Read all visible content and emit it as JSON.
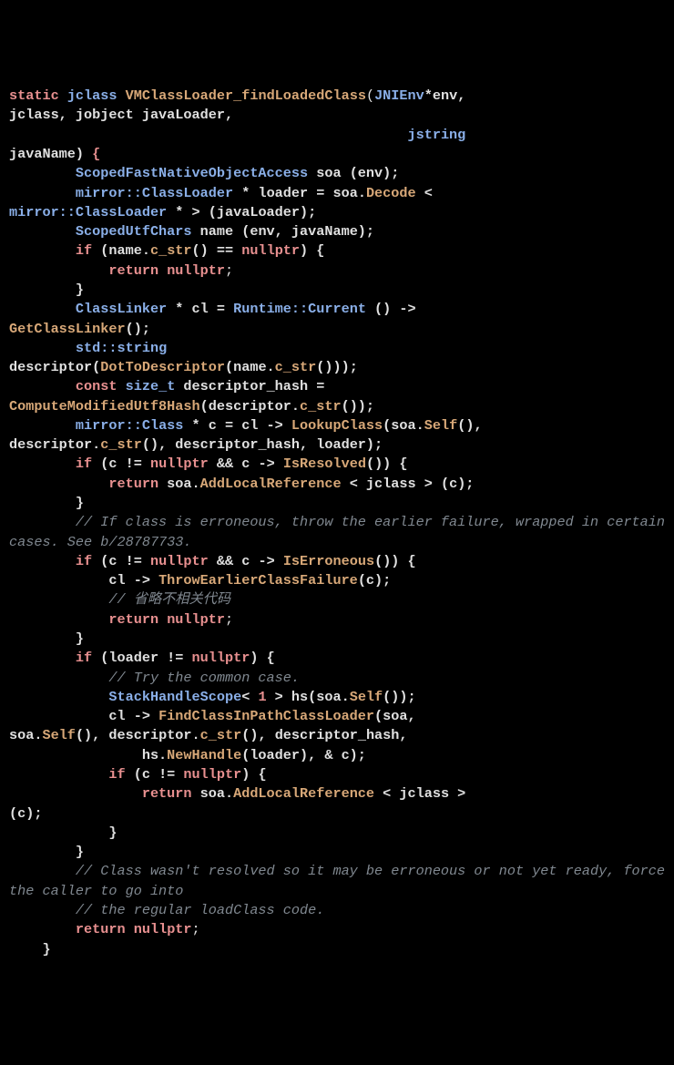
{
  "code": {
    "l1_static": "static",
    "l1_jclass": "jclass",
    "l1_fn": "VMClassLoader_findLoadedClass",
    "l1_jnienv": "JNIEnv",
    "l1_env": "*env,",
    "l2_jclass": "jclass, jobject javaLoader,",
    "l3_jstring": "jstring",
    "l4_javaname": "javaName)",
    "l4_brace": "{",
    "l5_scopedfast": "ScopedFastNativeObjectAccess",
    "l5_soa": " soa (env);",
    "l6_mirror": "mirror::",
    "l6_classloader": "ClassLoader",
    "l6_star": " * loader = soa.",
    "l6_decode": "Decode",
    "l6_lt": " <",
    "l7_mirror": "mirror::",
    "l7_classloader": "ClassLoader",
    "l7_rest": " * > (javaLoader);",
    "l8_scopedutf": "ScopedUtfChars",
    "l8_name": " name (env, javaName);",
    "l9_if": "if",
    "l9_cond": " (name.",
    "l9_cstr": "c_str",
    "l9_eq": "() == ",
    "l9_nullptr": "nullptr",
    "l9_brace": ") {",
    "l10_return": "return",
    "l10_nullptr": "nullptr",
    "l10_semi": ";",
    "l11_brace": "}",
    "l12_classlinker": "ClassLinker",
    "l12_cl": " * cl = ",
    "l12_runtime": "Runtime::Current",
    "l12_arrow": " () ->",
    "l13_getcl": "GetClassLinker",
    "l13_paren": "();",
    "l14_std": "std::",
    "l14_string": "string",
    "l15_desc": "descriptor(",
    "l15_dot": "DotToDescriptor",
    "l15_name": "(name.",
    "l15_cstr": "c_str",
    "l15_end": "()));",
    "l16_const": "const",
    "l16_sizet": "size_t",
    "l16_hash": " descriptor_hash =",
    "l17_compute": "ComputeModifiedUtf8Hash",
    "l17_desc": "(descriptor.",
    "l17_cstr": "c_str",
    "l17_end": "());",
    "l18_mirror": "mirror::",
    "l18_class": "Class",
    "l18_c": " * c = cl -> ",
    "l18_lookup": "LookupClass",
    "l18_soa": "(soa.",
    "l18_self": "Self",
    "l18_end": "(),",
    "l19_desc": "descriptor.",
    "l19_cstr": "c_str",
    "l19_rest": "(), descriptor_hash, loader);",
    "l20_if": "if",
    "l20_c": " (c != ",
    "l20_nullptr": "nullptr",
    "l20_and": " && c -> ",
    "l20_isres": "IsResolved",
    "l20_brace": "()) {",
    "l21_return": "return",
    "l21_soa": " soa.",
    "l21_add": "AddLocalReference",
    "l21_jclass": " < jclass > (c);",
    "l22_brace": "}",
    "l23_comment": "// If class is erroneous, throw the earlier failure, wrapped in certain cases. See b/28787733.",
    "l25_if": "if",
    "l25_c": " (c != ",
    "l25_nullptr": "nullptr",
    "l25_and": " && c -> ",
    "l25_iserr": "IsErroneous",
    "l25_brace": "()) {",
    "l26_cl": "cl -> ",
    "l26_throw": "ThrowEarlierClassFailure",
    "l26_c": "(c);",
    "l27_comment": "// 省略不相关代码",
    "l28_return": "return",
    "l28_nullptr": "nullptr",
    "l28_semi": ";",
    "l29_brace": "}",
    "l30_if": "if",
    "l30_loader": " (loader != ",
    "l30_nullptr": "nullptr",
    "l30_brace": ") {",
    "l31_comment": "// Try the common case.",
    "l32_stack": "StackHandleScope",
    "l32_lt": "< ",
    "l32_one": "1",
    "l32_hs": " > hs(soa.",
    "l32_self": "Self",
    "l32_end": "());",
    "l33_cl": "cl -> ",
    "l33_find": "FindClassInPathClassLoader",
    "l33_soa": "(soa,",
    "l34_soa": "soa.",
    "l34_self": "Self",
    "l34_desc": "(), descriptor.",
    "l34_cstr": "c_str",
    "l34_hash": "(), descriptor_hash,",
    "l35_hs": "hs.",
    "l35_new": "NewHandle",
    "l35_loader": "(loader), & c);",
    "l36_if": "if",
    "l36_c": " (c != ",
    "l36_nullptr": "nullptr",
    "l36_brace": ") {",
    "l37_return": "return",
    "l37_soa": " soa.",
    "l37_add": "AddLocalReference",
    "l37_jclass": " < jclass >",
    "l38_c": "(c);",
    "l39_brace": "}",
    "l40_brace": "}",
    "l41_comment": "// Class wasn't resolved so it may be erroneous or not yet ready, force the caller to go into",
    "l43_comment": "// the regular loadClass code.",
    "l44_return": "return",
    "l44_nullptr": "nullptr",
    "l44_semi": ";",
    "l45_brace": "}"
  }
}
